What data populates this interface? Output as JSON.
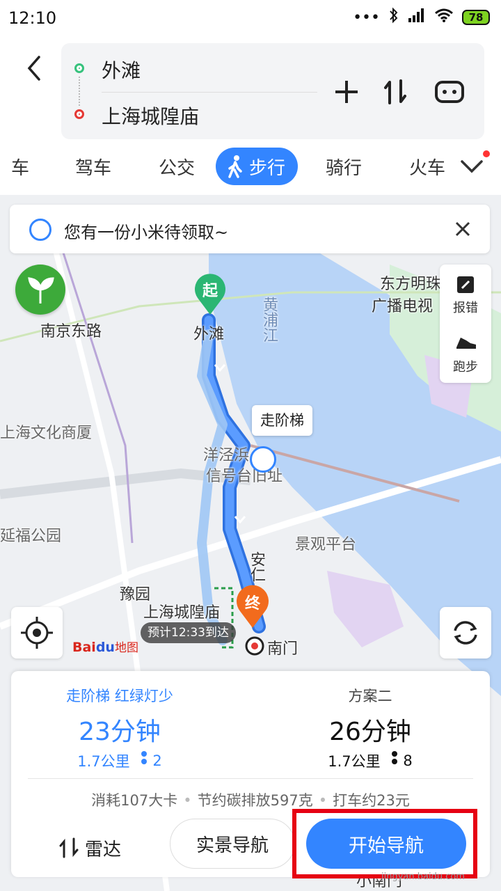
{
  "status_bar": {
    "time": "12:10",
    "signal_dots": "•••",
    "battery": "78"
  },
  "header": {
    "start_place": "外滩",
    "end_place": "上海城隍庙",
    "tabs": [
      {
        "label": "车"
      },
      {
        "label": "驾车"
      },
      {
        "label": "公交"
      },
      {
        "label": "步行",
        "active": true
      },
      {
        "label": "骑行"
      },
      {
        "label": "火车"
      }
    ]
  },
  "promo": {
    "text": "您有一份小米待领取~"
  },
  "map": {
    "labels": {
      "nanjing_east": "南京东路",
      "waitan": "外滩",
      "huangpu": "黄浦江",
      "dongfang": "东方明珠",
      "guangbo": "广播电视",
      "wenhua": "上海文化商厦",
      "yangjing": "洋泾浜",
      "xinhaotai": "信号台旧址",
      "yanfu": "延福公园",
      "jingguan": "景观平台",
      "yuyuan": "豫园",
      "chenghuangmiao": "上海城隍庙",
      "an": "安仁",
      "nanmen": "南门",
      "xiaonanmen": "小南门"
    },
    "start_pin": "起",
    "end_pin": "终",
    "eta": "预计12:33到达",
    "stairs_tag": "走阶梯",
    "side_buttons": {
      "report": "报错",
      "run": "跑步"
    },
    "logo": {
      "bai": "Bai",
      "du": "du",
      "suffix": "地图"
    }
  },
  "plans": [
    {
      "title": "走阶梯 红绿灯少",
      "time": "23分钟",
      "distance": "1.7公里",
      "lights": "2"
    },
    {
      "title": "方案二",
      "time": "26分钟",
      "distance": "1.7公里",
      "lights": "8"
    }
  ],
  "eco": {
    "calories": "消耗107大卡",
    "carbon": "节约碳排放597克",
    "taxi": "打车约23元",
    "sep": "•"
  },
  "actions": {
    "radar": "雷达",
    "ar_nav": "实景导航",
    "start_nav": "开始导航"
  },
  "watermark": "jingyan.baidu.com",
  "colors": {
    "accent": "#3385ff",
    "route": "#4a8cf0",
    "water": "#b8d4f7",
    "highlight": "#e60012"
  }
}
